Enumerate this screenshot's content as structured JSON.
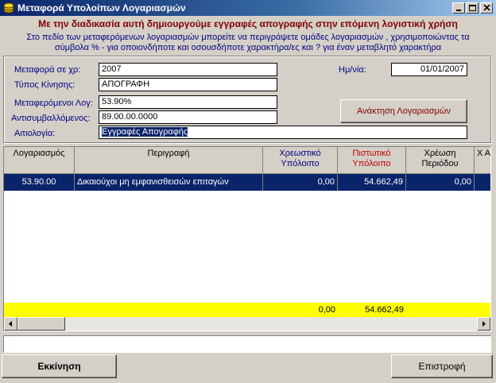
{
  "window": {
    "title": "Μεταφορά Υπολοίπων Λογαριασμών"
  },
  "heading": "Με την διαδικασία αυτή δημιουργούμε εγγραφές απογραφής στην επόμενη λογιστική χρήση",
  "info_line1": "Στο πεδίο των μεταφερόμενων λογαριασμών μπορείτε να περιγράψετε ομάδες λογαριασμών , χρησιμοποιώντας τα",
  "info_line2": "σύμβολα % - για οποιονδήποτε και οσουσδήποτε χαρακτήρα/ες και ? για έναν μεταβλητό χαρακτήρα",
  "form": {
    "year_label": "Μεταφορά σε χρ:",
    "year_value": "2007",
    "movement_type_label": "Τύπος Κίνησης:",
    "movement_type_value": "ΑΠΟΓΡΑΦΗ",
    "transferred_label": "Μεταφερόμενοι Λογ:",
    "transferred_value": "53.90%",
    "offset_label": "Αντισυμβαλλόμενος:",
    "offset_value": "89.00.00.0000",
    "reason_label": "Αιτιολογία:",
    "reason_value": "Εγγραφές Απογραφής",
    "date_label": "Ημ/νία:",
    "date_value": "01/01/2007",
    "retrieve_button": "Ανάκτηση Λογαριασμών"
  },
  "grid": {
    "columns": [
      {
        "label": "Λογαριασμός"
      },
      {
        "label": "Περιγραφή"
      },
      {
        "label": "Χρεωστικό Υπόλοιπο"
      },
      {
        "label": "Πιστωτικό Υπόλοιπο"
      },
      {
        "label": "Χρέωση Περιόδου"
      },
      {
        "label": "Χ Απ"
      }
    ],
    "rows": [
      {
        "account": "53.90.00",
        "description": "Δικαιούχοι μη εμφανισθεισών επιταγών",
        "debit_balance": "0,00",
        "credit_balance": "54.662,49",
        "period_debit": "0,00"
      }
    ],
    "totals": {
      "debit_balance": "0,00",
      "credit_balance": "54.662,49"
    }
  },
  "buttons": {
    "start": "Εκκίνηση",
    "back": "Επιστροφή"
  }
}
